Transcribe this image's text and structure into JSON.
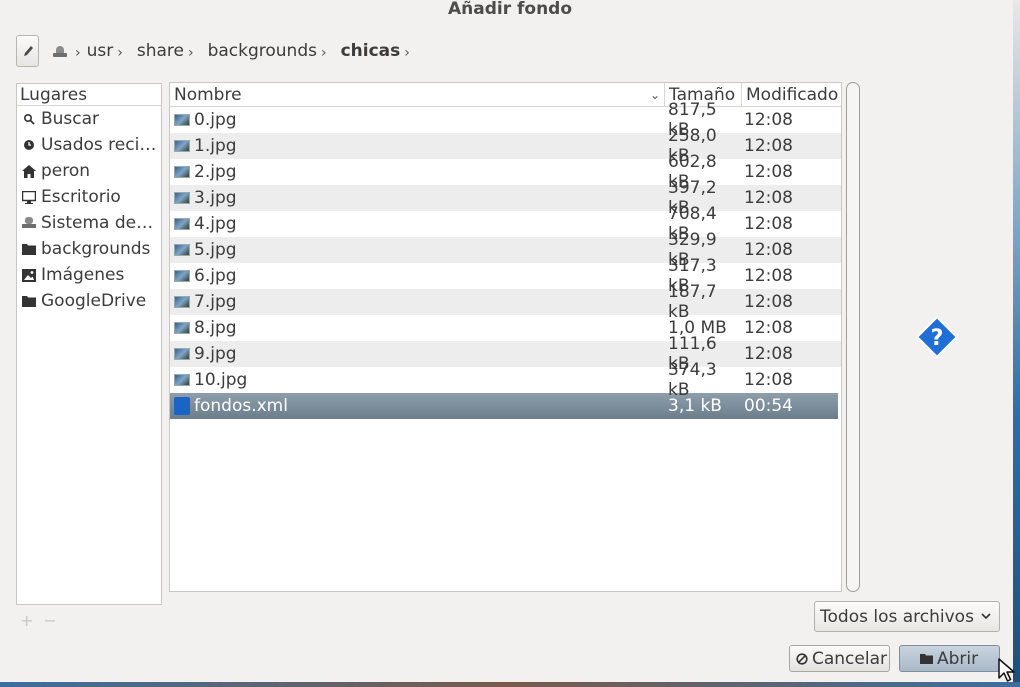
{
  "window": {
    "title": "Añadir fondo"
  },
  "pathbar": {
    "crumbs": [
      {
        "label": "usr"
      },
      {
        "label": "share"
      },
      {
        "label": "backgrounds"
      },
      {
        "label": "chicas"
      }
    ]
  },
  "places": {
    "header": "Lugares",
    "items": [
      {
        "label": "Buscar",
        "icon": "search-icon"
      },
      {
        "label": "Usados reci…",
        "icon": "clock-icon"
      },
      {
        "label": "peron",
        "icon": "home-icon"
      },
      {
        "label": "Escritorio",
        "icon": "desktop-icon"
      },
      {
        "label": "Sistema de …",
        "icon": "drive-icon"
      },
      {
        "label": "backgrounds",
        "icon": "folder-icon"
      },
      {
        "label": "Imágenes",
        "icon": "pictures-icon"
      },
      {
        "label": "GoogleDrive",
        "icon": "folder-icon"
      }
    ]
  },
  "filelist": {
    "columns": {
      "name": "Nombre",
      "size": "Tamaño",
      "modified": "Modificado"
    },
    "rows": [
      {
        "name": "0.jpg",
        "size": "817,5 kB",
        "modified": "12:08"
      },
      {
        "name": "1.jpg",
        "size": "258,0 kB",
        "modified": "12:08"
      },
      {
        "name": "2.jpg",
        "size": "602,8 kB",
        "modified": "12:08"
      },
      {
        "name": "3.jpg",
        "size": "397,2 kB",
        "modified": "12:08"
      },
      {
        "name": "4.jpg",
        "size": "708,4 kB",
        "modified": "12:08"
      },
      {
        "name": "5.jpg",
        "size": "329,9 kB",
        "modified": "12:08"
      },
      {
        "name": "6.jpg",
        "size": "317,3 kB",
        "modified": "12:08"
      },
      {
        "name": "7.jpg",
        "size": "187,7 kB",
        "modified": "12:08"
      },
      {
        "name": "8.jpg",
        "size": "1,0 MB",
        "modified": "12:08"
      },
      {
        "name": "9.jpg",
        "size": "111,6 kB",
        "modified": "12:08"
      },
      {
        "name": "10.jpg",
        "size": "374,3 kB",
        "modified": "12:08"
      },
      {
        "name": "fondos.xml",
        "size": "3,1 kB",
        "modified": "00:54"
      }
    ],
    "selected_index": 11
  },
  "preview": {
    "icon": "help-diamond-icon",
    "glyph": "?"
  },
  "filter": {
    "selected": "Todos los archivos"
  },
  "buttons": {
    "cancel": "Cancelar",
    "open": "Abrir"
  },
  "colors": {
    "selection": "#7a8b9a",
    "help_blue": "#1f6fd6"
  }
}
